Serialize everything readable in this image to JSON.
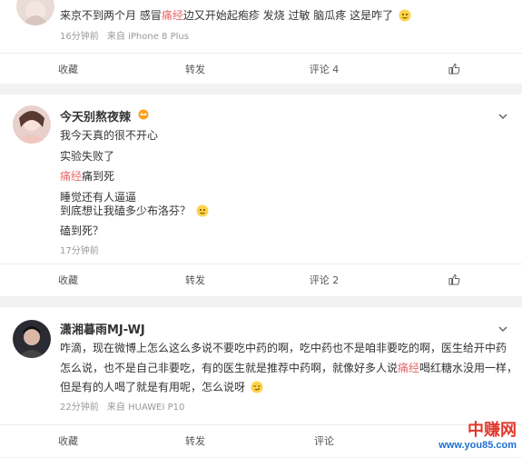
{
  "comments": [
    {
      "nick": "",
      "lines": [
        [
          "来京不到两个月 感冒",
          "痛经",
          "边又开始起疱疹 发烧 过敏 脑瓜疼 这是咋了"
        ]
      ],
      "time": "16分钟前",
      "source": "来自 iPhone 8 Plus",
      "actions": {
        "favorite": "收藏",
        "repost": "转发",
        "comment": "评论 4"
      }
    },
    {
      "nick": "今天别熬夜辣",
      "lines": [
        [
          "我今天真的很不开心"
        ],
        [
          "实验失败了"
        ],
        [
          "",
          "痛经",
          "痛到死"
        ],
        [
          "睡觉还有人逼逼"
        ],
        [
          "到底想让我磕多少布洛芬？"
        ],
        [
          "磕到死？"
        ]
      ],
      "time": "17分钟前",
      "source": "",
      "actions": {
        "favorite": "收藏",
        "repost": "转发",
        "comment": "评论 2"
      }
    },
    {
      "nick": "潇湘暮雨MJ-WJ",
      "lines": [
        [
          "咋滴，现在微博上怎么这么多说不要吃中药的啊，吃中药也不是咱非要吃的啊，医生给开中药"
        ],
        [
          "怎么说，也不是自己非要吃，有的医生就是推荐中药啊，就像好多人说",
          "痛经",
          "喝红糖水没用一样，"
        ],
        [
          "但是有的人喝了就是有用呢，怎么说呀"
        ]
      ],
      "time": "22分钟前",
      "source": "来自 HUAWEI P10",
      "actions": {
        "favorite": "收藏",
        "repost": "转发",
        "comment": "评论"
      }
    }
  ],
  "watermark": {
    "brand": "中赚网",
    "url": "www.you85.com"
  },
  "colors": {
    "highlight": "#e86a6a",
    "brand": "#e0382b",
    "url": "#1d6fd1"
  }
}
